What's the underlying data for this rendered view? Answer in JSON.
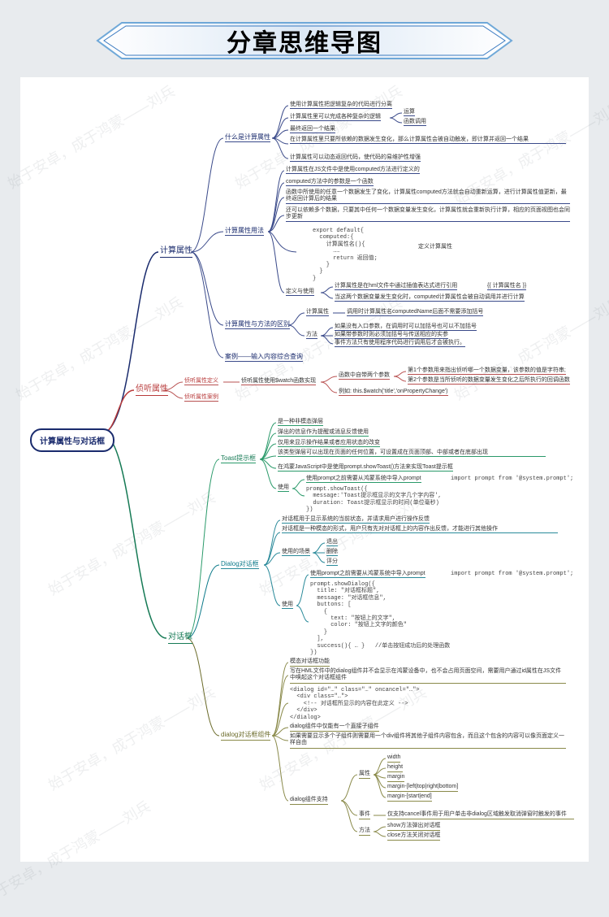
{
  "banner": {
    "title": "分章思维导图"
  },
  "watermark": "始于安卓，成于鸿蒙——刘兵",
  "root": {
    "label": "计算属性与对话框"
  },
  "l1": {
    "computed": "计算属性",
    "watch": "侦听属性",
    "dialog": "对话框"
  },
  "computed": {
    "what": "什么是计算属性",
    "usage": "计算属性用法",
    "diff": "计算属性与方法的区别",
    "case": "案例——输入内容综合查询",
    "what_items": {
      "a": "使用计算属性把逻辑复杂的代码进行分离",
      "b": "计算属性里可以完成各种复杂的逻辑",
      "b1": "运算",
      "b2": "函数调用",
      "c": "最终返回一个结果",
      "d": "在计算属性里只要所依赖的数据发生变化，那么计算属性会被自动触发，即计算并返回一个结果",
      "e": "计算属性可以动态返回代码，使代码的易维护性增强"
    },
    "usage_items": {
      "a": "计算属性在JS文件中是使用computed方法进行定义的",
      "b": "computed方法中的参数是一个函数",
      "c": "函数中所使用的任意一个数据发生了变化，计算属性computed方法就会自动重新运算，进行计算属性值更新，最终返回计算后的结果",
      "d": "还可以依赖多个数据，只要其中任何一个数据变量发生变化，计算属性就会重新执行计算，相应的页面视图也会同步更新",
      "code": "export default{\n  computed:{\n    计算属性名(){\n      ……\n      return 返回值;\n    }\n  }\n}",
      "code_note": "定义计算属性",
      "def": "定义与使用",
      "def_a": "计算属性是在hml文件中通过插值表达式进行引用",
      "def_a1": "{{ 计算属性名 }}",
      "def_b": "当这两个数据变量发生变化时，computed计算属性会被自动调用并进行计算"
    },
    "diff_items": {
      "comp": "计算属性",
      "comp_a": "调用时计算属性名computedName后面不需要添加括号",
      "method": "方法",
      "method_a": "如果没有入口参数，在调用时可以加括号也可以不加括号",
      "method_b": "如果带参数时则必须加括号与传送相应的实参",
      "method_c": "事件方法只有使用程序代码进行调用后才会被执行。"
    }
  },
  "watch": {
    "def": "侦听属性定义",
    "def_a": "侦听属性使用$watch函数实现",
    "def_a1": "函数中自带两个参数",
    "def_a1a": "第1个参数用来指出侦听哪一个数据变量，该参数的值是字符串;",
    "def_a1b": "第2个参数是当所侦听的数据变量发生变化之后所执行的回调函数",
    "def_a2": "例如: this.$watch('title','onPropertyChange')",
    "case": "侦听属性案例"
  },
  "dialog": {
    "toast": "Toast提示框",
    "toast_items": {
      "a": "是一种非模态弹层",
      "b": "弹出的信息作为提醒或消息反馈使用",
      "c": "仅用来显示操作结果或者应用状态的改变",
      "d": "该类型弹层可以出现在页面的任何位置，可设置成在页面顶部、中部或者在底部出现",
      "e": "在鸿蒙JavaScript中是使用prompt.showToast()方法来实现Toast提示框",
      "use": "使用",
      "use_a": "使用prompt之前需要从鸿蒙系统中导入prompt",
      "use_a_code": "import prompt from '@system.prompt';",
      "use_code": "prompt.showToast({\n  message:'Toast提示框显示的文字几个字内容',\n  duration: Toast提示框显示的时间(单位毫秒)\n})"
    },
    "dlg": "Dialog对话框",
    "dlg_items": {
      "a": "对话框用于显示系统的当前状态，并请求用户进行操作反馈",
      "b": "对话框是一种模态的形式，用户只有先对对话框上的内容作出反馈，才能进行其他操作",
      "scene": "使用的场景",
      "scene_a": "退出",
      "scene_b": "删除",
      "scene_c": "评分",
      "use": "使用",
      "use_a": "使用prompt之前需要从鸿蒙系统中导入prompt",
      "use_a_code": "import prompt from '@system.prompt';",
      "use_code": "prompt.showDialog({\n  title: \"对话框标题\",\n  message: \"对话框信息\",\n  buttons: [\n    {\n      text: \"按钮上的文字\",\n      color: \"按钮上文字的颜色\"\n    }\n  ],\n  success(){ … }   //单击按钮成功后的处理函数\n})"
    },
    "comp": "dialog对话框组件",
    "comp_items": {
      "a": "模态对话框功能",
      "b": "写在HML文件中的dialog组件并不会显示在鸿蒙设备中，也不会占用页面空间，需要用户通过id属性在JS文件中唤起这个对话框组件",
      "code": "<dialog id=\"…\" class=\"…\" oncancel=\"…\">\n  <div class=\"…\">\n    <!-- 对话框所显示的内容在此定义 -->\n  </div>\n</dialog>",
      "c": "dialog组件中仅能有一个直接子组件",
      "d": "如果需要显示多个子组件则需要用一个div组件将其他子组件内容包含，而且这个包含的内容可以像页面定义一样自由",
      "support": "dialog组件支持",
      "attr": "属性",
      "attr_a": "width",
      "attr_b": "height",
      "attr_c": "margin",
      "attr_d": "margin-[left|top|right|bottom]",
      "attr_e": "margin-[start|end]",
      "event": "事件",
      "event_a": "仅支持cancel事件用于用户单击非dialog区域触发取消弹窗时触发的事件",
      "method": "方法",
      "method_a": "show方法弹出对话框",
      "method_b": "close方法关闭对话框"
    }
  }
}
